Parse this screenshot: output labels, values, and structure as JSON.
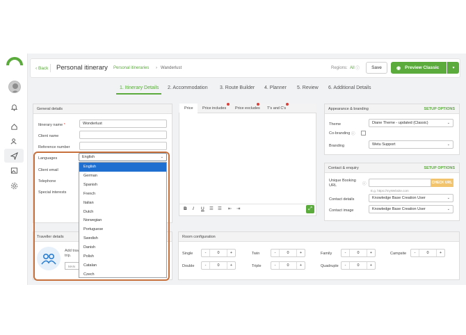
{
  "colors": {
    "accent": "#5aaa3c",
    "highlight_border": "#c8703c",
    "selected_option": "#1f6fd1",
    "required_star": "#d9413a"
  },
  "header": {
    "back_label": "Back",
    "title": "Personal itinerary",
    "breadcrumb_link": "Personal itineraries",
    "breadcrumb_sep": "›",
    "breadcrumb_current": "Wanderlust",
    "regions_label": "Regions:",
    "regions_value": "All",
    "save_label": "Save",
    "preview_label": "Preview Classic"
  },
  "steps": [
    {
      "label": "1. Itinerary Details",
      "active": true
    },
    {
      "label": "2. Accommodation"
    },
    {
      "label": "3. Route Builder"
    },
    {
      "label": "4. Planner"
    },
    {
      "label": "5. Review"
    },
    {
      "label": "6. Additional Details"
    }
  ],
  "general": {
    "title": "General details",
    "itinerary_name_label": "Itinerary name",
    "required_mark": "*",
    "itinerary_name_value": "Wonderlust",
    "client_name_label": "Client name",
    "reference_label": "Reference number",
    "languages_label": "Languages",
    "languages_value": "English",
    "client_email_label": "Client email",
    "telephone_label": "Telephone",
    "special_interests_label": "Special interests"
  },
  "language_options": [
    "English",
    "German",
    "Spanish",
    "French",
    "Italian",
    "Dutch",
    "Norwegian",
    "Portuguese",
    "Swedish",
    "Danish",
    "Polish",
    "Catalan",
    "Czech"
  ],
  "price_tabs": [
    "Price",
    "Price includes",
    "Price excludes",
    "T's and C's"
  ],
  "editor_toolbar": {
    "bold": "B",
    "italic": "I",
    "underline": "U"
  },
  "appearance": {
    "title": "Appearance & branding",
    "setup_label": "SETUP OPTIONS",
    "theme_label": "Theme",
    "theme_value": "Diane Theme - updated (Classic)",
    "cobranding_label": "Co-branding",
    "branding_label": "Branding",
    "branding_value": "Wetu Support"
  },
  "contact": {
    "title": "Contact & enquiry",
    "setup_label": "SETUP OPTIONS",
    "unique_url_label_1": "Unique Booking",
    "unique_url_label_2": "URL",
    "check_url_label": "CHECK URL",
    "url_placeholder": "E.g. https://myWebsite.com",
    "contact_details_label": "Contact details",
    "contact_details_value": "Knowledge Base Creation User",
    "contact_image_label": "Contact image",
    "contact_image_value": "Knowledge Base Creation User"
  },
  "traveller": {
    "title": "Traveller details",
    "add_text_1": "Add trav",
    "add_text_2": "trip.",
    "manage_label": "MAN"
  },
  "room": {
    "title": "Room configuration",
    "rows": [
      [
        {
          "label": "Single",
          "value": "0"
        },
        {
          "label": "Twin",
          "value": "0"
        },
        {
          "label": "Family",
          "value": "0"
        },
        {
          "label": "Campsite",
          "value": "0"
        }
      ],
      [
        {
          "label": "Double",
          "value": "0"
        },
        {
          "label": "Triple",
          "value": "0"
        },
        {
          "label": "Quadruple",
          "value": "0"
        }
      ]
    ],
    "minus": "-",
    "plus": "+"
  }
}
